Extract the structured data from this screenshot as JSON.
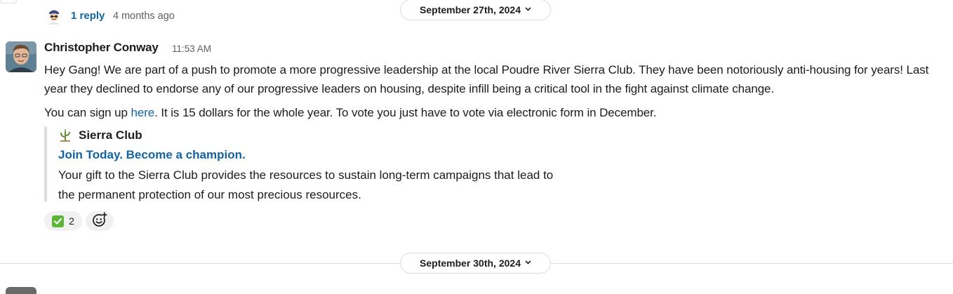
{
  "thread": {
    "reply_count": "1 reply",
    "reply_time": "4 months ago"
  },
  "dividers": [
    {
      "label": "September 27th, 2024"
    },
    {
      "label": "September 30th, 2024"
    }
  ],
  "message": {
    "sender": "Christopher Conway",
    "time": "11:53 AM",
    "body": "Hey Gang! We are part of a push to promote a more progressive leadership at the local Poudre River Sierra Club. They have been notoriously anti-housing for years! Last year they declined to endorse any of our progressive leaders on housing, despite infill being a critical tool in the fight against climate change.",
    "p2_prefix": "You can sign up ",
    "p2_link": "here",
    "p2_suffix": ". It is 15 dollars for the whole year. To vote you just have to vote via electronic form in December."
  },
  "attachment": {
    "site_name": "Sierra Club",
    "title": "Join Today. Become a champion.",
    "description": "Your gift to the Sierra Club provides the resources to sustain long-term campaigns that lead to the permanent protection of our most precious resources."
  },
  "reactions": [
    {
      "emoji": "white-check-mark",
      "count": "2"
    }
  ],
  "colors": {
    "link": "#1264a3",
    "muted": "#616061",
    "text": "#1d1c1d",
    "border": "#dddddd",
    "reaction_bg": "#f1f1f1",
    "check_green": "#5bb536"
  }
}
